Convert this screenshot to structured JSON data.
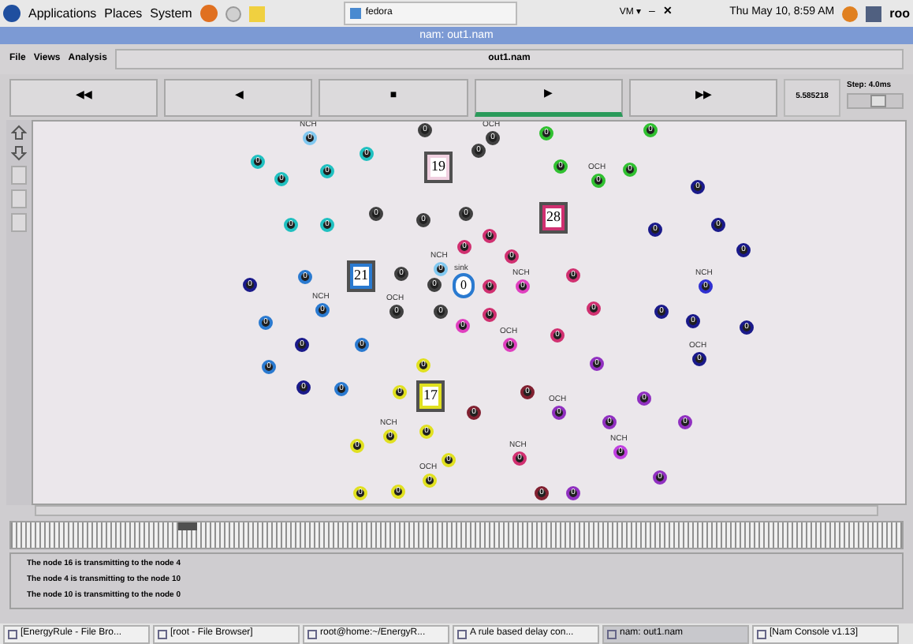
{
  "top_panel": {
    "menus": [
      "Applications",
      "Places",
      "System"
    ],
    "window_button": "fedora",
    "vm_menu": "VM ▾",
    "clock": "Thu May 10,  8:59 AM",
    "user": "roo",
    "minimize": "–",
    "close": "✕"
  },
  "window": {
    "title": "nam: out1.nam"
  },
  "menu_bar": {
    "items": [
      "File",
      "Views",
      "Analysis"
    ],
    "file_name": "out1.nam"
  },
  "controls": [
    {
      "symbol": "◀◀",
      "selected": false
    },
    {
      "symbol": "◀",
      "selected": false
    },
    {
      "symbol": "■",
      "selected": false
    },
    {
      "symbol": "▶",
      "selected": true
    },
    {
      "symbol": "▶▶",
      "selected": false
    }
  ],
  "time": "5.585218",
  "step": {
    "label": "Step: 4.0ms",
    "level": 0.6
  },
  "nodes": [
    {
      "kind": "node",
      "label": "0",
      "color": "#80c8f0",
      "tag": "NCH"
    },
    {
      "kind": "node",
      "label": "0",
      "color": "#404040"
    },
    {
      "kind": "node",
      "label": "0",
      "color": "#404040",
      "tag": "OCH"
    },
    {
      "kind": "node",
      "label": "0",
      "color": "#30c030"
    },
    {
      "kind": "node",
      "label": "0",
      "color": "#30c030"
    },
    {
      "kind": "node",
      "label": "0",
      "color": "#20c0c0"
    },
    {
      "kind": "node",
      "label": "0",
      "color": "#20c0c0"
    },
    {
      "kind": "node",
      "label": "0",
      "color": "#20c0c0"
    },
    {
      "kind": "node",
      "label": "0",
      "color": "#20c0c0"
    },
    {
      "kind": "box",
      "label": "19",
      "color": "#f0d0e0"
    },
    {
      "kind": "node",
      "label": "0",
      "color": "#404040"
    },
    {
      "kind": "node",
      "label": "0",
      "color": "#30c030"
    },
    {
      "kind": "node",
      "label": "0",
      "color": "#30c030",
      "tag": "OCH"
    },
    {
      "kind": "node",
      "label": "0",
      "color": "#30c030"
    },
    {
      "kind": "node",
      "label": "0",
      "color": "#1a1a8a"
    },
    {
      "kind": "node",
      "label": "0",
      "color": "#20c0c0"
    },
    {
      "kind": "node",
      "label": "0",
      "color": "#20c0c0"
    },
    {
      "kind": "node",
      "label": "0",
      "color": "#404040"
    },
    {
      "kind": "node",
      "label": "0",
      "color": "#404040"
    },
    {
      "kind": "node",
      "label": "0",
      "color": "#404040"
    },
    {
      "kind": "box",
      "label": "28",
      "color": "#d03070"
    },
    {
      "kind": "node",
      "label": "0",
      "color": "#1a1a8a"
    },
    {
      "kind": "node",
      "label": "0",
      "color": "#1a1a8a"
    },
    {
      "kind": "node",
      "label": "0",
      "color": "#1a1a8a"
    },
    {
      "kind": "node",
      "label": "0",
      "color": "#80c8f0",
      "tag": "NCH"
    },
    {
      "kind": "node",
      "label": "0",
      "color": "#d03070"
    },
    {
      "kind": "node",
      "label": "0",
      "color": "#d03070"
    },
    {
      "kind": "node",
      "label": "0",
      "color": "#d03070"
    },
    {
      "kind": "node",
      "label": "0",
      "color": "#1a1a8a"
    },
    {
      "kind": "node",
      "label": "0",
      "color": "#2a7ad0"
    },
    {
      "kind": "box",
      "label": "21",
      "color": "#2a7ad0"
    },
    {
      "kind": "node",
      "label": "0",
      "color": "#404040"
    },
    {
      "kind": "node",
      "label": "0",
      "color": "#404040"
    },
    {
      "kind": "sink",
      "label": "0",
      "color": "#2a7ad0",
      "tag": "sink"
    },
    {
      "kind": "node",
      "label": "0",
      "color": "#d03070"
    },
    {
      "kind": "node",
      "label": "0",
      "color": "#e040c0",
      "tag": "NCH"
    },
    {
      "kind": "node",
      "label": "0",
      "color": "#d03070"
    },
    {
      "kind": "node",
      "label": "0",
      "color": "#3030d0",
      "tag": "NCH"
    },
    {
      "kind": "node",
      "label": "0",
      "color": "#2a7ad0",
      "tag": "NCH"
    },
    {
      "kind": "node",
      "label": "0",
      "color": "#404040",
      "tag": "OCH"
    },
    {
      "kind": "node",
      "label": "0",
      "color": "#404040"
    },
    {
      "kind": "node",
      "label": "0",
      "color": "#e040c0"
    },
    {
      "kind": "node",
      "label": "0",
      "color": "#d03070"
    },
    {
      "kind": "node",
      "label": "0",
      "color": "#d03070"
    },
    {
      "kind": "node",
      "label": "0",
      "color": "#1a1a8a"
    },
    {
      "kind": "node",
      "label": "0",
      "color": "#1a1a8a"
    },
    {
      "kind": "node",
      "label": "0",
      "color": "#1a1a8a"
    },
    {
      "kind": "node",
      "label": "0",
      "color": "#2a7ad0"
    },
    {
      "kind": "node",
      "label": "0",
      "color": "#1a1a8a"
    },
    {
      "kind": "node",
      "label": "0",
      "color": "#2a7ad0"
    },
    {
      "kind": "node",
      "label": "0",
      "color": "#e040c0",
      "tag": "OCH"
    },
    {
      "kind": "node",
      "label": "0",
      "color": "#d03070"
    },
    {
      "kind": "node",
      "label": "0",
      "color": "#9030c0"
    },
    {
      "kind": "node",
      "label": "0",
      "color": "#1a1a8a",
      "tag": "OCH"
    },
    {
      "kind": "node",
      "label": "0",
      "color": "#2a7ad0"
    },
    {
      "kind": "node",
      "label": "0",
      "color": "#e0e020"
    },
    {
      "kind": "node",
      "label": "0",
      "color": "#1a1a8a"
    },
    {
      "kind": "node",
      "label": "0",
      "color": "#2a7ad0"
    },
    {
      "kind": "node",
      "label": "0",
      "color": "#e0e020"
    },
    {
      "kind": "box",
      "label": "17",
      "color": "#e0e020"
    },
    {
      "kind": "node",
      "label": "0",
      "color": "#802030"
    },
    {
      "kind": "node",
      "label": "0",
      "color": "#802030"
    },
    {
      "kind": "node",
      "label": "0",
      "color": "#9030c0",
      "tag": "OCH"
    },
    {
      "kind": "node",
      "label": "0",
      "color": "#9030c0"
    },
    {
      "kind": "node",
      "label": "0",
      "color": "#e0e020"
    },
    {
      "kind": "node",
      "label": "0",
      "color": "#e0e020",
      "tag": "NCH"
    },
    {
      "kind": "node",
      "label": "0",
      "color": "#e0e020"
    },
    {
      "kind": "node",
      "label": "0",
      "color": "#9030c0"
    },
    {
      "kind": "node",
      "label": "0",
      "color": "#9030c0"
    },
    {
      "kind": "node",
      "label": "0",
      "color": "#e0e020"
    },
    {
      "kind": "node",
      "label": "0",
      "color": "#e0e020"
    },
    {
      "kind": "node",
      "label": "0",
      "color": "#e0e020",
      "tag": "OCH"
    },
    {
      "kind": "node",
      "label": "0",
      "color": "#e0e020"
    },
    {
      "kind": "node",
      "label": "0",
      "color": "#d03070",
      "tag": "NCH"
    },
    {
      "kind": "node",
      "label": "0",
      "color": "#c040e0",
      "tag": "NCH"
    },
    {
      "kind": "node",
      "label": "0",
      "color": "#9030c0"
    },
    {
      "kind": "node",
      "label": "0",
      "color": "#802030"
    },
    {
      "kind": "node",
      "label": "0",
      "color": "#9030c0"
    }
  ],
  "log": [
    "The node 16 is transmitting to the node 4",
    "The node 4 is transmitting to the node 10",
    "The node 10 is transmitting to the node 0"
  ],
  "taskbar": [
    {
      "label": "[EnergyRule - File Bro...",
      "selected": false
    },
    {
      "label": "[root - File Browser]",
      "selected": false
    },
    {
      "label": "root@home:~/EnergyR...",
      "selected": false
    },
    {
      "label": "A rule based delay con...",
      "selected": false
    },
    {
      "label": "nam: out1.nam",
      "selected": true
    },
    {
      "label": "[Nam Console v1.13]",
      "selected": false
    }
  ]
}
